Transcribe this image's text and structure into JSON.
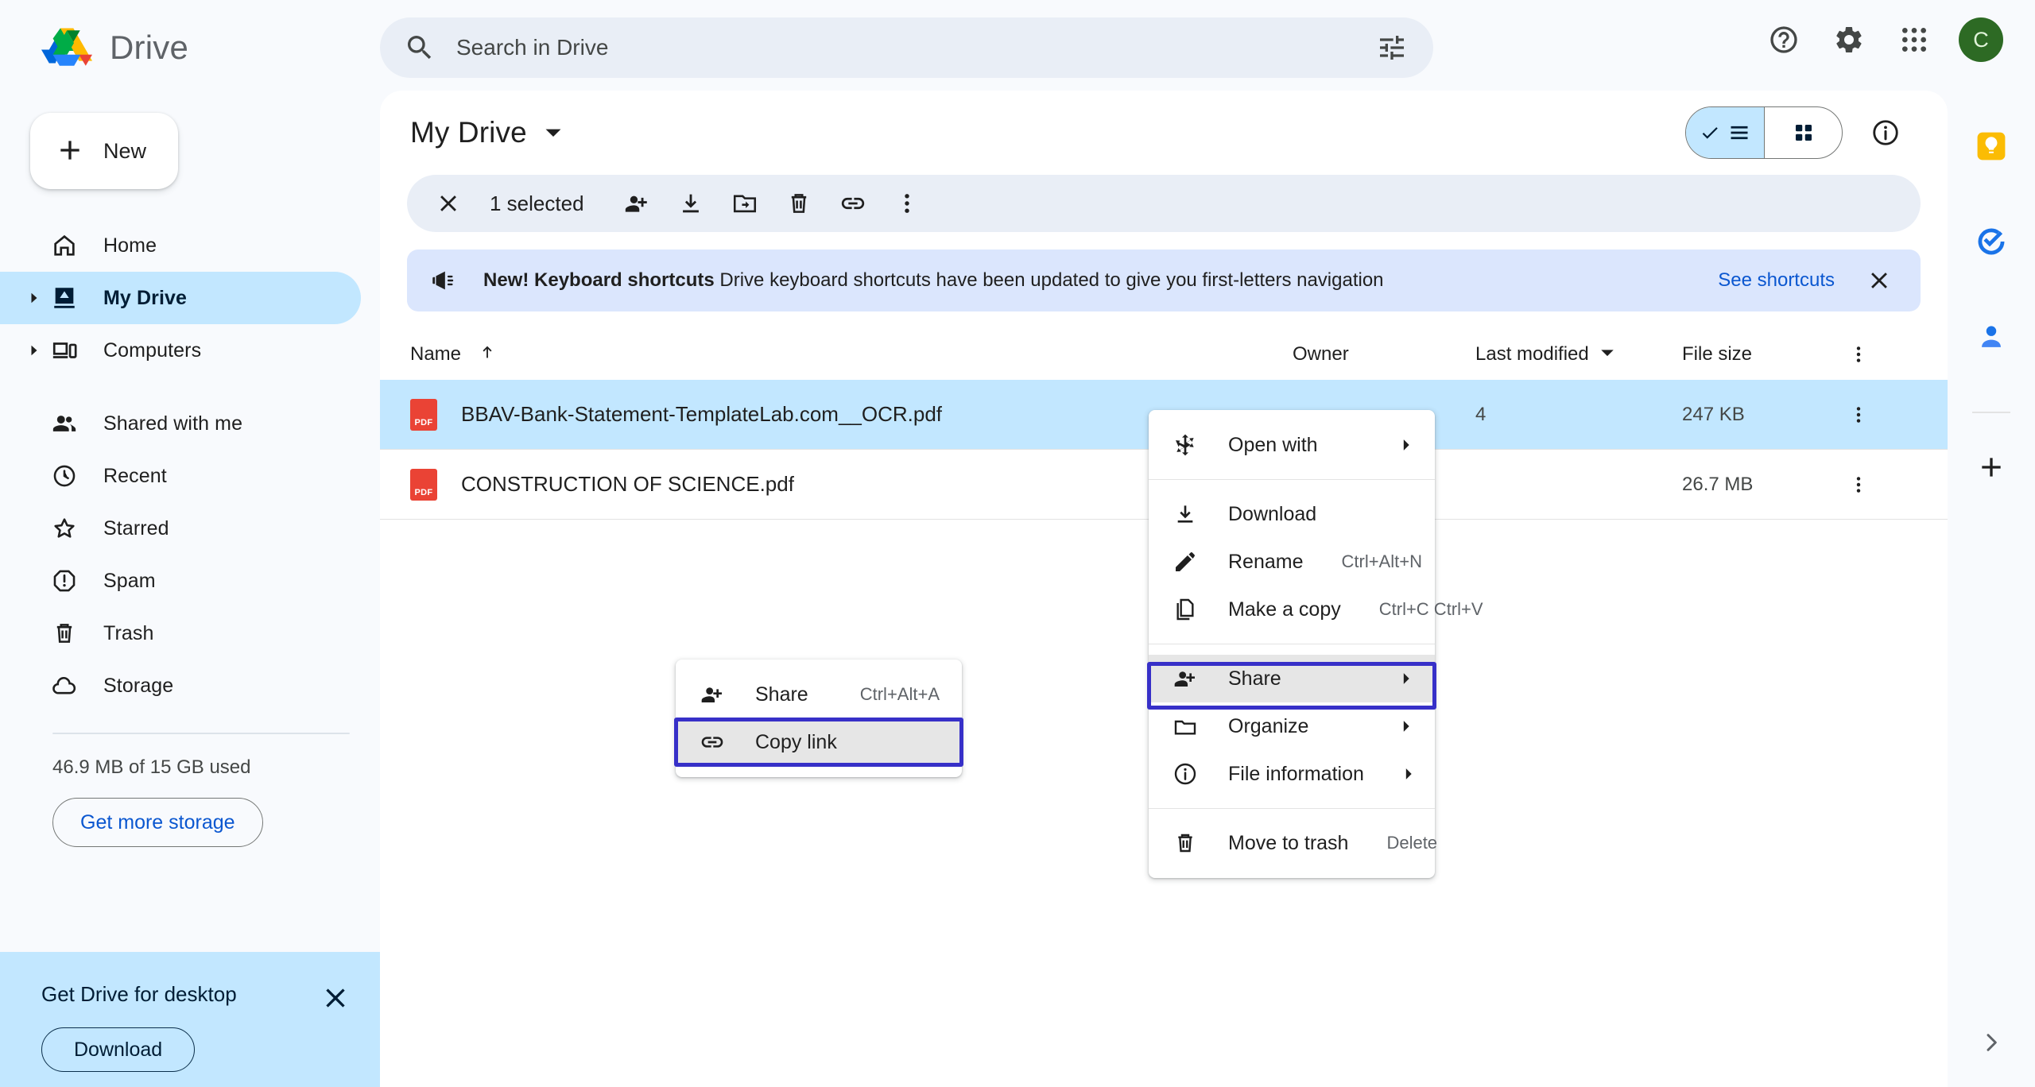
{
  "app": {
    "brand": "Drive",
    "logo_colors": {
      "green": "#34a853",
      "yellow": "#fbbc04",
      "blue": "#4285f4",
      "red": "#ea4335",
      "dark_green": "#188038",
      "dark_blue": "#1a73e8"
    }
  },
  "search": {
    "placeholder": "Search in Drive",
    "value": "",
    "icon": "search-icon",
    "filter_icon": "tune-icon"
  },
  "top_actions": [
    {
      "name": "help-icon",
      "label": "Support"
    },
    {
      "name": "gear-icon",
      "label": "Settings"
    },
    {
      "name": "apps-grid-icon",
      "label": "Google apps"
    }
  ],
  "account": {
    "initial": "C",
    "color": "#2d6a24"
  },
  "sidebar": {
    "new_button": {
      "label": "New",
      "icon": "plus-icon"
    },
    "items": [
      {
        "label": "Home",
        "icon": "home-icon",
        "expandable": false,
        "active": false
      },
      {
        "label": "My Drive",
        "icon": "my-drive-icon",
        "expandable": true,
        "active": true
      },
      {
        "label": "Computers",
        "icon": "computers-icon",
        "expandable": true,
        "active": false
      },
      {
        "label": "Shared with me",
        "icon": "people-icon",
        "expandable": false,
        "active": false
      },
      {
        "label": "Recent",
        "icon": "clock-icon",
        "expandable": false,
        "active": false
      },
      {
        "label": "Starred",
        "icon": "star-icon",
        "expandable": false,
        "active": false
      },
      {
        "label": "Spam",
        "icon": "spam-icon",
        "expandable": false,
        "active": false
      },
      {
        "label": "Trash",
        "icon": "trash-icon",
        "expandable": false,
        "active": false
      },
      {
        "label": "Storage",
        "icon": "cloud-icon",
        "expandable": false,
        "active": false
      }
    ],
    "storage_text": "46.9 MB of 15 GB used",
    "storage_button": "Get more storage",
    "promo": {
      "title": "Get Drive for desktop",
      "button": "Download",
      "close_icon": "close-icon",
      "bg": "#c2e7ff"
    }
  },
  "main": {
    "title": "My Drive",
    "title_caret_icon": "chevron-down-icon",
    "view_toggle": {
      "list": {
        "icon": "list-view-icon",
        "selected": true,
        "check_icon": "check-icon"
      },
      "grid": {
        "icon": "grid-view-icon",
        "selected": false
      }
    },
    "details_button": {
      "icon": "info-icon"
    },
    "selection_bar": {
      "close_icon": "close-icon",
      "count_label": "1 selected",
      "actions": [
        {
          "name": "share-icon",
          "label": "Share"
        },
        {
          "name": "download-icon",
          "label": "Download"
        },
        {
          "name": "move-to-folder-icon",
          "label": "Move"
        },
        {
          "name": "trash-icon",
          "label": "Move to trash"
        },
        {
          "name": "link-icon",
          "label": "Get link"
        },
        {
          "name": "more-vert-icon",
          "label": "More actions"
        }
      ]
    },
    "banner": {
      "icon": "campaign-icon",
      "bold_text": "New! Keyboard shortcuts",
      "text": "Drive keyboard shortcuts have been updated to give you first-letters navigation",
      "link": "See shortcuts",
      "close_icon": "close-icon",
      "bg": "#dbe6fd"
    },
    "table": {
      "columns": [
        {
          "key": "name",
          "label": "Name",
          "sort_icon": "arrow-up-icon"
        },
        {
          "key": "owner",
          "label": "Owner"
        },
        {
          "key": "modified",
          "label": "Last modified",
          "sort_icon": "chevron-down-icon"
        },
        {
          "key": "size",
          "label": "File size"
        }
      ],
      "more_icon": "more-vert-icon",
      "rows": [
        {
          "icon": "pdf-icon",
          "icon_label": "PDF",
          "name": "BBAV-Bank-Statement-TemplateLab.com__OCR.pdf",
          "owner": "",
          "modified": "4",
          "size": "247 KB",
          "selected": true
        },
        {
          "icon": "pdf-icon",
          "icon_label": "PDF",
          "name": "CONSTRUCTION OF SCIENCE.pdf",
          "owner": "",
          "modified": "",
          "size": "26.7 MB",
          "selected": false
        }
      ]
    }
  },
  "context_menu": {
    "items": [
      {
        "label": "Open with",
        "icon": "open-with-icon",
        "accel": "",
        "submenu": true,
        "highlighted": false,
        "sep_after": true
      },
      {
        "label": "Download",
        "icon": "download-icon",
        "accel": "",
        "submenu": false,
        "highlighted": false,
        "sep_after": false
      },
      {
        "label": "Rename",
        "icon": "pencil-icon",
        "accel": "Ctrl+Alt+N",
        "submenu": false,
        "highlighted": false,
        "sep_after": false
      },
      {
        "label": "Make a copy",
        "icon": "copy-icon",
        "accel": "Ctrl+C Ctrl+V",
        "submenu": false,
        "highlighted": false,
        "sep_after": true
      },
      {
        "label": "Share",
        "icon": "share-icon",
        "accel": "",
        "submenu": true,
        "highlighted": true,
        "sep_after": false
      },
      {
        "label": "Organize",
        "icon": "folder-icon",
        "accel": "",
        "submenu": true,
        "highlighted": false,
        "sep_after": false
      },
      {
        "label": "File information",
        "icon": "info-icon",
        "accel": "",
        "submenu": true,
        "highlighted": false,
        "sep_after": true
      },
      {
        "label": "Move to trash",
        "icon": "trash-icon",
        "accel": "Delete",
        "submenu": false,
        "highlighted": false,
        "sep_after": false
      }
    ]
  },
  "share_submenu": {
    "items": [
      {
        "label": "Share",
        "icon": "share-icon",
        "accel": "Ctrl+Alt+A",
        "highlighted": false
      },
      {
        "label": "Copy link",
        "icon": "link-icon",
        "accel": "",
        "highlighted": true
      }
    ]
  },
  "focus_color": "#3730c8",
  "rail": {
    "items": [
      {
        "name": "keep-icon",
        "label": "Keep",
        "color": "#fbbc04"
      },
      {
        "name": "tasks-icon",
        "label": "Tasks",
        "color": "#1a73e8"
      },
      {
        "name": "contacts-icon",
        "label": "Contacts",
        "color": "#1a73e8"
      }
    ],
    "add_button": {
      "icon": "plus-icon",
      "label": "Get add-ons"
    },
    "expand_button": {
      "icon": "chevron-right-icon",
      "label": "Show side panel"
    }
  }
}
